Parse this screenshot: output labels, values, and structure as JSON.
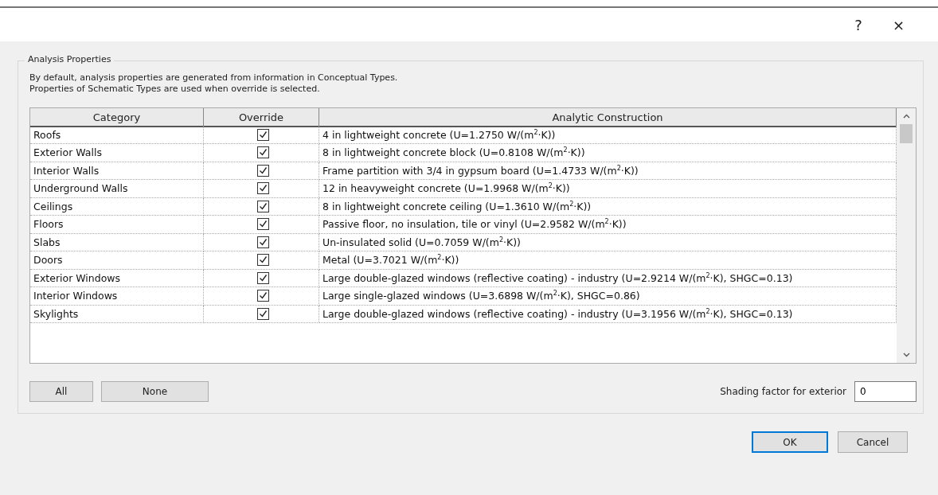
{
  "window": {
    "help": "?",
    "close": "×"
  },
  "group": {
    "title": "Analysis Properties",
    "description": [
      "By default, analysis properties are generated from information in Conceptual Types.",
      "Properties of Schematic Types are used when override is selected."
    ]
  },
  "table": {
    "columns": [
      "Category",
      "Override",
      "Analytic Construction"
    ],
    "rows": [
      {
        "category": "Roofs",
        "override": true,
        "construction": "4 in lightweight concrete (U=1.2750 W/(m$^{2}$·K))"
      },
      {
        "category": "Exterior Walls",
        "override": true,
        "construction": "8 in lightweight concrete block (U=0.8108 W/(m$^{2}$·K))"
      },
      {
        "category": "Interior Walls",
        "override": true,
        "construction": "Frame partition with 3/4 in gypsum board (U=1.4733 W/(m$^{2}$·K))"
      },
      {
        "category": "Underground Walls",
        "override": true,
        "construction": "12 in heavyweight concrete (U=1.9968 W/(m$^{2}$·K))"
      },
      {
        "category": "Ceilings",
        "override": true,
        "construction": "8 in lightweight concrete ceiling (U=1.3610 W/(m$^{2}$·K))"
      },
      {
        "category": "Floors",
        "override": true,
        "construction": "Passive floor, no insulation, tile or vinyl (U=2.9582 W/(m$^{2}$·K))"
      },
      {
        "category": "Slabs",
        "override": true,
        "construction": "Un-insulated solid (U=0.7059 W/(m$^{2}$·K))"
      },
      {
        "category": "Doors",
        "override": true,
        "construction": "Metal (U=3.7021 W/(m$^{2}$·K))"
      },
      {
        "category": "Exterior Windows",
        "override": true,
        "construction": "Large double-glazed windows (reflective coating) - industry (U=2.9214 W/(m$^{2}$·K), SHGC=0.13)"
      },
      {
        "category": "Interior Windows",
        "override": true,
        "construction": "Large single-glazed windows (U=3.6898 W/(m$^{2}$·K), SHGC=0.86)"
      },
      {
        "category": "Skylights",
        "override": true,
        "construction": "Large double-glazed windows (reflective coating) - industry (U=3.1956 W/(m$^{2}$·K), SHGC=0.13)"
      }
    ]
  },
  "buttons_left": [
    "All",
    "None"
  ],
  "shading": {
    "label": "Shading factor for exterior",
    "value": "0"
  },
  "buttons": [
    "OK",
    "Cancel"
  ]
}
